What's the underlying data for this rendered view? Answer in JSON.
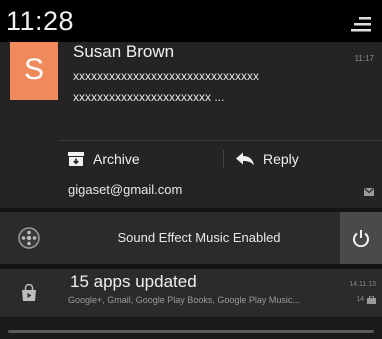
{
  "status_bar": {
    "time": "11:28",
    "settings_icon": "quick-settings-icon"
  },
  "email_notification": {
    "avatar_letter": "S",
    "avatar_color": "#f08a5d",
    "sender": "Susan Brown",
    "time": "11:17",
    "preview_line1": "xxxxxxxxxxxxxxxxxxxxxxxxxxxxxxx",
    "preview_line2": "xxxxxxxxxxxxxxxxxxxxxxx ...",
    "actions": {
      "archive_label": "Archive",
      "archive_icon": "archive-icon",
      "reply_label": "Reply",
      "reply_icon": "reply-arrow-icon"
    },
    "account": "gigaset@gmail.com",
    "account_icon": "gmail-icon"
  },
  "sound_notification": {
    "icon": "sound-effect-icon",
    "text": "Sound Effect Music Enabled",
    "power_icon": "power-icon"
  },
  "apps_notification": {
    "icon": "play-store-bag-icon",
    "title": "15 apps updated",
    "subtitle": "Google+, Gmail, Google Play Books, Google Play Music...",
    "date": "14.11.13",
    "count": "14"
  }
}
